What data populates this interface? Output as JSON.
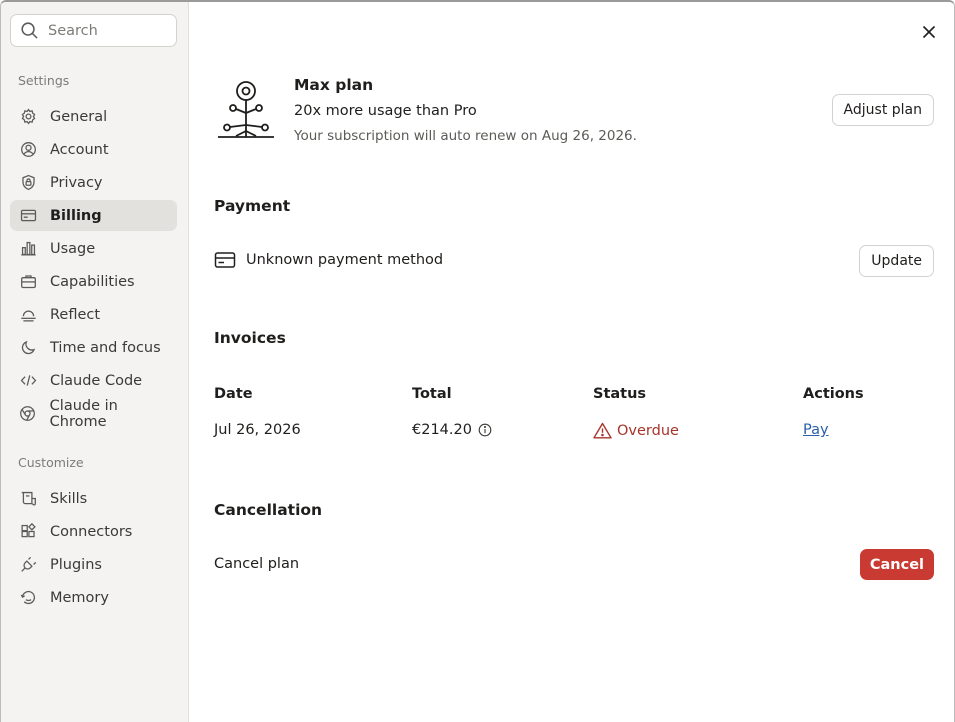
{
  "search": {
    "placeholder": "Search"
  },
  "sidebar": {
    "settings_label": "Settings",
    "settings_items": [
      {
        "label": "General",
        "icon": "gear-icon"
      },
      {
        "label": "Account",
        "icon": "user-circle-icon"
      },
      {
        "label": "Privacy",
        "icon": "shield-lock-icon"
      },
      {
        "label": "Billing",
        "icon": "credit-card-icon",
        "active": true
      },
      {
        "label": "Usage",
        "icon": "bar-chart-icon"
      },
      {
        "label": "Capabilities",
        "icon": "briefcase-icon"
      },
      {
        "label": "Reflect",
        "icon": "sunrise-icon"
      },
      {
        "label": "Time and focus",
        "icon": "moon-icon"
      },
      {
        "label": "Claude Code",
        "icon": "code-icon"
      },
      {
        "label": "Claude in Chrome",
        "icon": "globe-icon"
      }
    ],
    "customize_label": "Customize",
    "customize_items": [
      {
        "label": "Skills",
        "icon": "skills-icon"
      },
      {
        "label": "Connectors",
        "icon": "connectors-icon"
      },
      {
        "label": "Plugins",
        "icon": "plug-icon"
      },
      {
        "label": "Memory",
        "icon": "memory-icon"
      }
    ]
  },
  "plan": {
    "title": "Max plan",
    "subtitle": "20x more usage than Pro",
    "renew_text": "Your subscription will auto renew on Aug 26, 2026.",
    "adjust_label": "Adjust plan"
  },
  "payment": {
    "heading": "Payment",
    "method_text": "Unknown payment method",
    "update_label": "Update"
  },
  "invoices": {
    "heading": "Invoices",
    "columns": [
      "Date",
      "Total",
      "Status",
      "Actions"
    ],
    "rows": [
      {
        "date": "Jul 26, 2026",
        "total": "€214.20",
        "status": "Overdue",
        "action": "Pay"
      }
    ]
  },
  "cancellation": {
    "heading": "Cancellation",
    "label": "Cancel plan",
    "button_label": "Cancel"
  },
  "colors": {
    "sidebar_bg": "#f4f3f1",
    "active_item_bg": "#e3e1dd",
    "overdue": "#a7332a",
    "link": "#2b5fa8",
    "danger_button": "#c93a32"
  }
}
